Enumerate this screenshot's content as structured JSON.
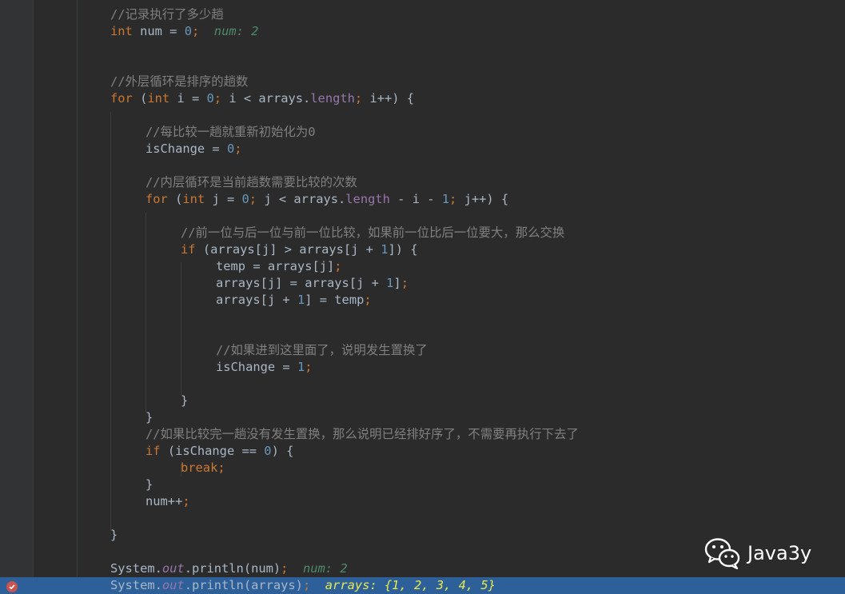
{
  "editor": {
    "lines": [
      {
        "indent": 0,
        "tokens": [
          {
            "c": "cm",
            "t": "//记录执行了多少趟"
          }
        ]
      },
      {
        "indent": 0,
        "tokens": [
          {
            "c": "kw",
            "t": "int"
          },
          {
            "c": "pl",
            "t": " num = "
          },
          {
            "c": "num",
            "t": "0"
          },
          {
            "c": "kw",
            "t": ";"
          },
          {
            "c": "pl",
            "t": "  "
          },
          {
            "c": "inl",
            "t": "num: 2"
          }
        ]
      },
      {
        "indent": 0,
        "tokens": []
      },
      {
        "indent": 0,
        "tokens": []
      },
      {
        "indent": 0,
        "tokens": [
          {
            "c": "cm",
            "t": "//外层循环是排序的趟数"
          }
        ]
      },
      {
        "indent": 0,
        "tokens": [
          {
            "c": "kw",
            "t": "for"
          },
          {
            "c": "pl",
            "t": " ("
          },
          {
            "c": "kw",
            "t": "int"
          },
          {
            "c": "pl",
            "t": " i = "
          },
          {
            "c": "num",
            "t": "0"
          },
          {
            "c": "kw",
            "t": ";"
          },
          {
            "c": "pl",
            "t": " i < arrays."
          },
          {
            "c": "fld",
            "t": "length"
          },
          {
            "c": "kw",
            "t": ";"
          },
          {
            "c": "pl",
            "t": " i++) {"
          }
        ]
      },
      {
        "indent": 0,
        "tokens": []
      },
      {
        "indent": 1,
        "tokens": [
          {
            "c": "cm",
            "t": "//每比较一趟就重新初始化为0"
          }
        ]
      },
      {
        "indent": 1,
        "tokens": [
          {
            "c": "pl",
            "t": "isChange = "
          },
          {
            "c": "num",
            "t": "0"
          },
          {
            "c": "kw",
            "t": ";"
          }
        ]
      },
      {
        "indent": 0,
        "tokens": []
      },
      {
        "indent": 1,
        "tokens": [
          {
            "c": "cm",
            "t": "//内层循环是当前趟数需要比较的次数"
          }
        ]
      },
      {
        "indent": 1,
        "tokens": [
          {
            "c": "kw",
            "t": "for"
          },
          {
            "c": "pl",
            "t": " ("
          },
          {
            "c": "kw",
            "t": "int"
          },
          {
            "c": "pl",
            "t": " j = "
          },
          {
            "c": "num",
            "t": "0"
          },
          {
            "c": "kw",
            "t": ";"
          },
          {
            "c": "pl",
            "t": " j < arrays."
          },
          {
            "c": "fld",
            "t": "length"
          },
          {
            "c": "pl",
            "t": " - i - "
          },
          {
            "c": "num",
            "t": "1"
          },
          {
            "c": "kw",
            "t": ";"
          },
          {
            "c": "pl",
            "t": " j++) {"
          }
        ]
      },
      {
        "indent": 0,
        "tokens": []
      },
      {
        "indent": 2,
        "tokens": [
          {
            "c": "cm",
            "t": "//前一位与后一位与前一位比较，如果前一位比后一位要大，那么交换"
          }
        ]
      },
      {
        "indent": 2,
        "tokens": [
          {
            "c": "kw",
            "t": "if"
          },
          {
            "c": "pl",
            "t": " (arrays[j] > arrays[j + "
          },
          {
            "c": "num",
            "t": "1"
          },
          {
            "c": "pl",
            "t": "]) {"
          }
        ]
      },
      {
        "indent": 3,
        "tokens": [
          {
            "c": "pl",
            "t": "temp = arrays[j]"
          },
          {
            "c": "kw",
            "t": ";"
          }
        ]
      },
      {
        "indent": 3,
        "tokens": [
          {
            "c": "pl",
            "t": "arrays[j] = arrays[j + "
          },
          {
            "c": "num",
            "t": "1"
          },
          {
            "c": "pl",
            "t": "]"
          },
          {
            "c": "kw",
            "t": ";"
          }
        ]
      },
      {
        "indent": 3,
        "tokens": [
          {
            "c": "pl",
            "t": "arrays[j + "
          },
          {
            "c": "num",
            "t": "1"
          },
          {
            "c": "pl",
            "t": "] = temp"
          },
          {
            "c": "kw",
            "t": ";"
          }
        ]
      },
      {
        "indent": 0,
        "tokens": []
      },
      {
        "indent": 0,
        "tokens": []
      },
      {
        "indent": 3,
        "tokens": [
          {
            "c": "cm",
            "t": "//如果进到这里面了，说明发生置换了"
          }
        ]
      },
      {
        "indent": 3,
        "tokens": [
          {
            "c": "pl",
            "t": "isChange = "
          },
          {
            "c": "num",
            "t": "1"
          },
          {
            "c": "kw",
            "t": ";"
          }
        ]
      },
      {
        "indent": 0,
        "tokens": []
      },
      {
        "indent": 2,
        "tokens": [
          {
            "c": "pl",
            "t": "}"
          }
        ]
      },
      {
        "indent": 1,
        "tokens": [
          {
            "c": "pl",
            "t": "}"
          }
        ]
      },
      {
        "indent": 1,
        "tokens": [
          {
            "c": "cm",
            "t": "//如果比较完一趟没有发生置换，那么说明已经排好序了，不需要再执行下去了"
          }
        ]
      },
      {
        "indent": 1,
        "tokens": [
          {
            "c": "kw",
            "t": "if"
          },
          {
            "c": "pl",
            "t": " (isChange == "
          },
          {
            "c": "num",
            "t": "0"
          },
          {
            "c": "pl",
            "t": ") {"
          }
        ]
      },
      {
        "indent": 2,
        "tokens": [
          {
            "c": "kw",
            "t": "break;"
          }
        ]
      },
      {
        "indent": 1,
        "tokens": [
          {
            "c": "pl",
            "t": "}"
          }
        ]
      },
      {
        "indent": 1,
        "tokens": [
          {
            "c": "pl",
            "t": "num++"
          },
          {
            "c": "kw",
            "t": ";"
          }
        ]
      },
      {
        "indent": 0,
        "tokens": []
      },
      {
        "indent": 0,
        "tokens": [
          {
            "c": "pl",
            "t": "}"
          }
        ]
      },
      {
        "indent": 0,
        "tokens": []
      },
      {
        "indent": 0,
        "tokens": [
          {
            "c": "pl",
            "t": "System."
          },
          {
            "c": "st",
            "t": "out"
          },
          {
            "c": "pl",
            "t": ".println(num)"
          },
          {
            "c": "kw",
            "t": ";"
          },
          {
            "c": "pl",
            "t": "  "
          },
          {
            "c": "inl",
            "t": "num: 2"
          }
        ]
      },
      {
        "indent": 0,
        "highlighted": true,
        "tokens": [
          {
            "c": "pl",
            "t": "System."
          },
          {
            "c": "st",
            "t": "out"
          },
          {
            "c": "pl",
            "t": ".println(arrays)"
          },
          {
            "c": "kw",
            "t": ";"
          },
          {
            "c": "pl",
            "t": "  "
          },
          {
            "c": "inl-hl",
            "t": "arrays: {1, 2, 3, 4, 5}"
          }
        ]
      }
    ]
  },
  "breakpoint": {
    "icon": "breakpoint-check-icon",
    "color": "#c75450"
  },
  "watermark": {
    "icon": "wechat-icon",
    "text": "Java3y"
  },
  "colors": {
    "background": "#2b2b2b",
    "keyword": "#cc7832",
    "number": "#6897bb",
    "comment": "#808080",
    "field": "#9876aa",
    "inline_value": "#4f8a6a",
    "execution_line": "#2d6099"
  }
}
